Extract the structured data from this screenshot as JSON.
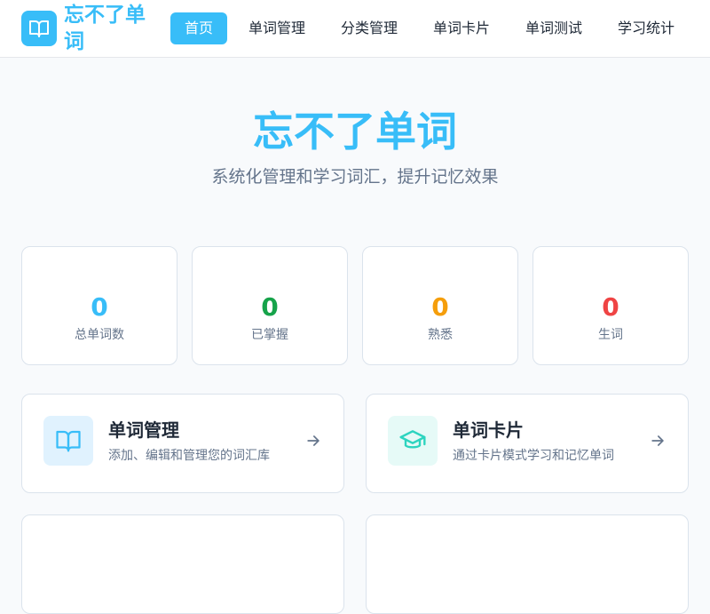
{
  "brand": {
    "name": "忘不了单词",
    "icon": "open-book-icon",
    "color": "#38bdf8"
  },
  "nav": {
    "items": [
      {
        "label": "首页",
        "active": true
      },
      {
        "label": "单词管理",
        "active": false
      },
      {
        "label": "分类管理",
        "active": false
      },
      {
        "label": "单词卡片",
        "active": false
      },
      {
        "label": "单词测试",
        "active": false
      },
      {
        "label": "学习统计",
        "active": false
      }
    ]
  },
  "hero": {
    "title": "忘不了单词",
    "subtitle": "系统化管理和学习词汇，提升记忆效果"
  },
  "stats": [
    {
      "value": "0",
      "label": "总单词数",
      "color": "#38bdf8"
    },
    {
      "value": "0",
      "label": "已掌握",
      "color": "#16a34a"
    },
    {
      "value": "0",
      "label": "熟悉",
      "color": "#f59e0b"
    },
    {
      "value": "0",
      "label": "生词",
      "color": "#ef4444"
    }
  ],
  "features": [
    {
      "title": "单词管理",
      "description": "添加、编辑和管理您的词汇库",
      "icon": "open-book-icon",
      "accent": "#38bdf8"
    },
    {
      "title": "单词卡片",
      "description": "通过卡片模式学习和记忆单词",
      "icon": "graduation-cap-icon",
      "accent": "#2dd4bf"
    }
  ]
}
